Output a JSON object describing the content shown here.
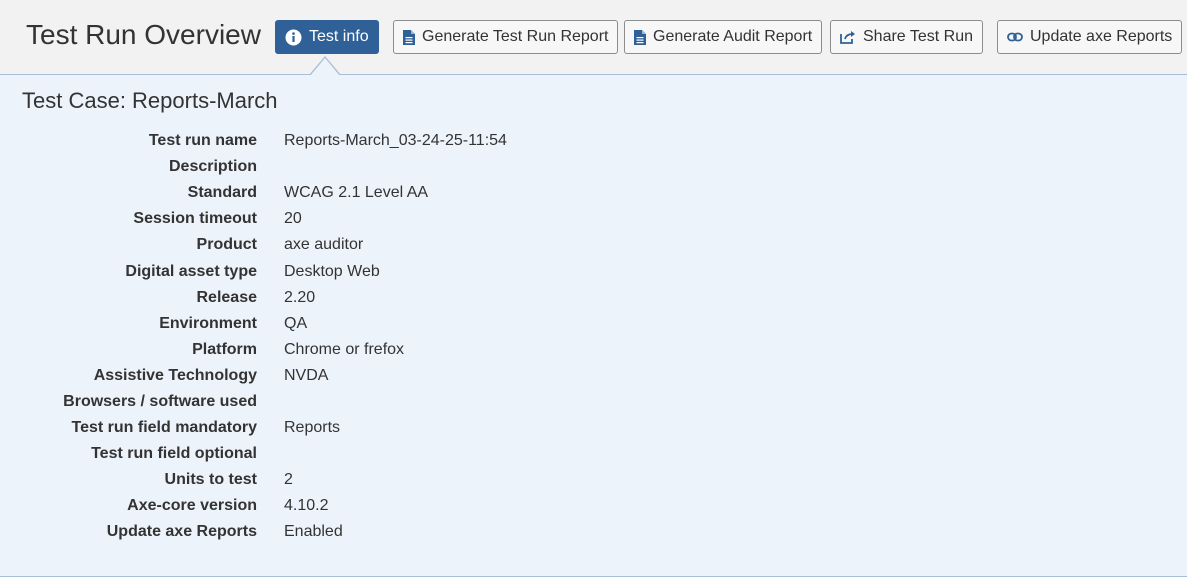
{
  "header": {
    "title": "Test Run Overview",
    "buttons": {
      "test_info": "Test info",
      "generate_test_run_report": "Generate Test Run Report",
      "generate_audit_report": "Generate Audit Report",
      "share_test_run": "Share Test Run",
      "update_axe_reports": "Update axe Reports"
    },
    "icons": {
      "test_info": "info-icon",
      "generate_test_run_report": "document-icon",
      "generate_audit_report": "document-icon",
      "share_test_run": "share-icon",
      "update_axe_reports": "link-icon"
    }
  },
  "test_case": {
    "title": "Test Case: Reports-March",
    "fields": [
      {
        "label": "Test run name",
        "value": "Reports-March_03-24-25-11:54"
      },
      {
        "label": "Description",
        "value": ""
      },
      {
        "label": "Standard",
        "value": "WCAG 2.1 Level AA"
      },
      {
        "label": "Session timeout",
        "value": "20"
      },
      {
        "label": "Product",
        "value": "axe auditor"
      },
      {
        "label": "Digital asset type",
        "value": "Desktop Web"
      },
      {
        "label": "Release",
        "value": "2.20"
      },
      {
        "label": "Environment",
        "value": "QA"
      },
      {
        "label": "Platform",
        "value": "Chrome or frefox"
      },
      {
        "label": "Assistive Technology",
        "value": "NVDA"
      },
      {
        "label": "Browsers / software used",
        "value": ""
      },
      {
        "label": "Test run field mandatory",
        "value": "Reports"
      },
      {
        "label": "Test run field optional",
        "value": ""
      },
      {
        "label": "Units to test",
        "value": "2"
      },
      {
        "label": "Axe-core version",
        "value": "4.10.2"
      },
      {
        "label": "Update axe Reports",
        "value": "Enabled"
      }
    ]
  },
  "colors": {
    "accent": "#2f6198",
    "panel_bg": "#edf3fb",
    "header_bg": "#f2f2f2"
  }
}
